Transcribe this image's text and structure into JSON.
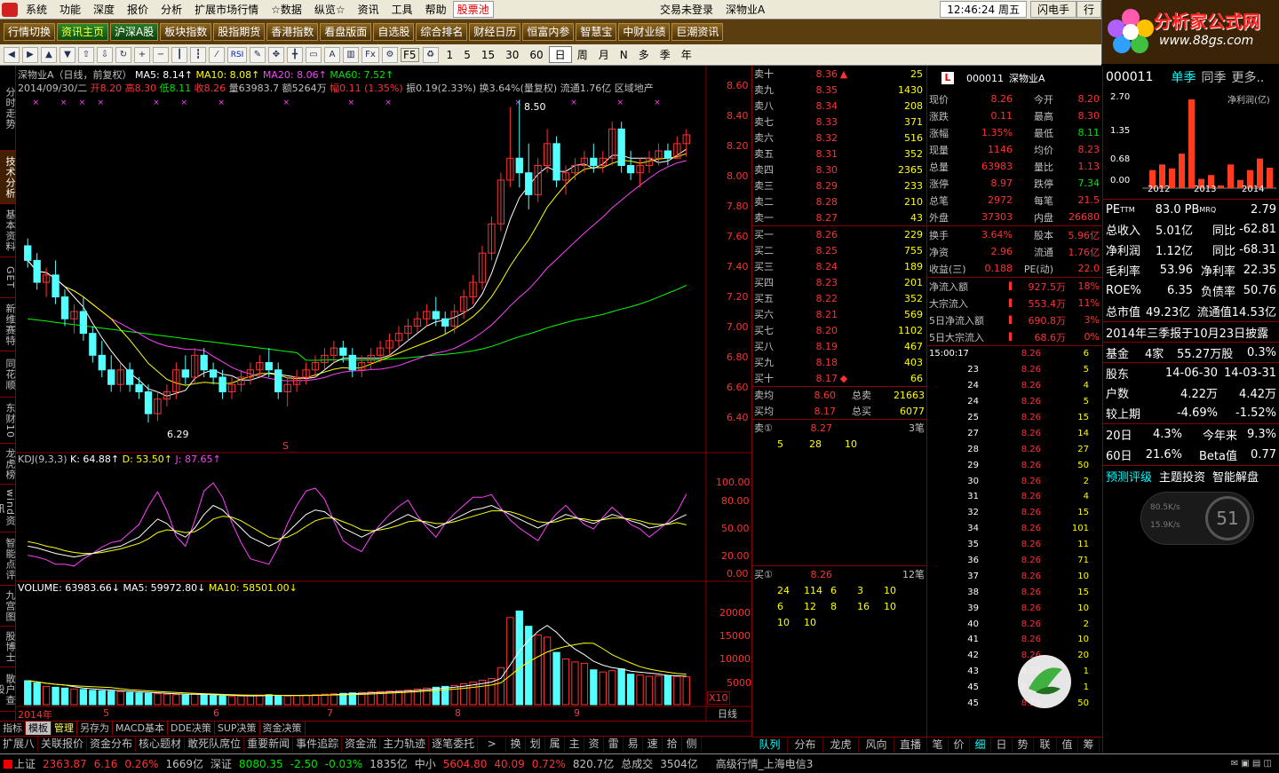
{
  "menu": [
    "系统",
    "功能",
    "深度",
    "报价",
    "分析",
    "扩展市场行情",
    "☆数据",
    "纵览☆",
    "资讯",
    "工具",
    "帮助",
    "股票池"
  ],
  "menu_center": "交易未登录",
  "menu_stock": "深物业A",
  "menu_time": "12:46:24 周五",
  "menu_btn": "闪电手",
  "menu_btn2": "行",
  "nav": [
    "行情切换",
    "资讯主页",
    "沪深A股",
    "板块指数",
    "股指期货",
    "香港指数",
    "看盘版面",
    "自选股",
    "综合排名",
    "财经日历",
    "恒富内参",
    "智慧宝",
    "中财业绩",
    "巨潮资讯"
  ],
  "logo_title": "分析家公式网",
  "logo_url": "www.88gs.com",
  "toolbar_text": [
    "F5",
    "1",
    "5",
    "15",
    "30",
    "60",
    "日",
    "周",
    "月",
    "N",
    "多",
    "季",
    "年"
  ],
  "left_tabs": [
    "分时走势",
    "技术分析",
    "基本资料",
    "GET",
    "新维赛特",
    "同花顺",
    "东财10",
    "龙虎榜",
    "wind资讯",
    "智能点评",
    "九宫图",
    "股博士",
    "散户查股"
  ],
  "chart_header": {
    "line1": "深物业A（日线，前复权）",
    "ma5": "MA5: 8.14↑",
    "ma10": "MA10: 8.08↑",
    "ma20": "MA20: 8.06↑",
    "ma60": "MA60: 7.52↑",
    "date": "2014/09/30/二",
    "open": "开8.20",
    "high": "高8.30",
    "low": "低8.11",
    "close": "收8.26",
    "vol": "量63983.7",
    "amt": "额5264万",
    "chg": "幅0.11 (1.35%)",
    "amp": "振0.19(2.33%)",
    "turn": "换3.64%(量复权)",
    "float": "流通1.76亿",
    "region": "区域地产"
  },
  "price_axis": [
    "8.60",
    "8.40",
    "8.20",
    "8.00",
    "7.80",
    "7.60",
    "7.40",
    "7.20",
    "7.00",
    "6.80",
    "6.60",
    "6.40"
  ],
  "hi_label": "8.50",
  "lo_label": "6.29",
  "s_marker": "S",
  "kdj_header": {
    "name": "KDJ(9,3,3)",
    "k": "K: 64.88↑",
    "d": "D: 53.50↑",
    "j": "J: 87.65↑"
  },
  "kdj_axis": [
    "100.00",
    "80.00",
    "50.00",
    "20.00",
    "0.00"
  ],
  "vol_header": {
    "vol": "VOLUME: 63983.66↓",
    "ma5": "MA5: 59972.80↓",
    "ma10": "MA10: 58501.00↓"
  },
  "vol_axis": [
    "20000",
    "15000",
    "10000",
    "5000"
  ],
  "vol_unit": "X10",
  "date_axis": [
    "2014年",
    "5",
    "6",
    "7",
    "8",
    "9"
  ],
  "period": "日线",
  "bottom_tabs": [
    "指标",
    "模板",
    "管理",
    "另存为",
    "MACD基本",
    "DDE决策",
    "SUP决策",
    "资金决策"
  ],
  "bottom_tabs2": [
    "扩展八",
    "关联报价",
    "资金分布",
    "核心题材",
    "敢死队席位",
    "重要新闻",
    "事件追踪",
    "资金流",
    "主力轨迹",
    "逐笔委托",
    ">",
    "换",
    "划",
    "属",
    "主",
    "资",
    "雷",
    "易",
    "速",
    "拾",
    "侧"
  ],
  "order_book": {
    "sell": [
      [
        "卖十",
        "8.36",
        "25"
      ],
      [
        "卖九",
        "8.35",
        "1430"
      ],
      [
        "卖八",
        "8.34",
        "208"
      ],
      [
        "卖七",
        "8.33",
        "371"
      ],
      [
        "卖六",
        "8.32",
        "516"
      ],
      [
        "卖五",
        "8.31",
        "352"
      ],
      [
        "卖四",
        "8.30",
        "2365"
      ],
      [
        "卖三",
        "8.29",
        "233"
      ],
      [
        "卖二",
        "8.28",
        "210"
      ],
      [
        "卖一",
        "8.27",
        "43"
      ]
    ],
    "buy": [
      [
        "买一",
        "8.26",
        "229"
      ],
      [
        "买二",
        "8.25",
        "755"
      ],
      [
        "买三",
        "8.24",
        "189"
      ],
      [
        "买四",
        "8.23",
        "201"
      ],
      [
        "买五",
        "8.22",
        "352"
      ],
      [
        "买六",
        "8.21",
        "569"
      ],
      [
        "买七",
        "8.20",
        "1102"
      ],
      [
        "买八",
        "8.19",
        "467"
      ],
      [
        "买九",
        "8.18",
        "403"
      ],
      [
        "买十",
        "8.17",
        "66"
      ]
    ],
    "avg_sell": [
      "卖均",
      "8.60",
      "总卖",
      "21663"
    ],
    "avg_buy": [
      "买均",
      "8.17",
      "总买",
      "6077"
    ],
    "sell1_head": [
      "卖①",
      "8.27",
      "3笔"
    ],
    "sell1_q": [
      "5",
      "28",
      "10"
    ],
    "buy1_head": [
      "买①",
      "8.26",
      "12笔"
    ],
    "buy1_q": [
      [
        "24",
        "114",
        "6",
        "3",
        "10"
      ],
      [
        "6",
        "12",
        "8",
        "16",
        "10"
      ],
      [
        "10",
        "10"
      ]
    ],
    "tabs": [
      "队列",
      "分布",
      "龙虎",
      "风向",
      "直播"
    ]
  },
  "quote": {
    "code": "000011",
    "name": "深物业A",
    "rows": [
      [
        "现价",
        "8.26",
        "今开",
        "8.20"
      ],
      [
        "涨跌",
        "0.11",
        "最高",
        "8.30"
      ],
      [
        "涨幅",
        "1.35%",
        "最低",
        "8.11"
      ],
      [
        "现量",
        "1146",
        "均价",
        "8.23"
      ],
      [
        "总量",
        "63983",
        "量比",
        "1.13"
      ],
      [
        "涨停",
        "8.97",
        "跌停",
        "7.34"
      ],
      [
        "总笔",
        "2972",
        "每笔",
        "21.5"
      ],
      [
        "外盘",
        "37303",
        "内盘",
        "26680"
      ]
    ],
    "rows2": [
      [
        "换手",
        "3.64%",
        "股本",
        "5.96亿"
      ],
      [
        "净资",
        "2.96",
        "流通",
        "1.76亿"
      ],
      [
        "收益(三)",
        "0.188",
        "PE(动)",
        "22.0"
      ]
    ],
    "flow": [
      [
        "净流入额",
        "927.5万",
        "18%"
      ],
      [
        "大宗流入",
        "553.4万",
        "11%"
      ],
      [
        "5日净流入额",
        "690.8万",
        "3%"
      ],
      [
        "5日大宗流入",
        "68.6万",
        "0%"
      ]
    ],
    "ticks_start": "15:00:17",
    "ticks": [
      [
        "23",
        "8.26",
        "5"
      ],
      [
        "24",
        "8.26",
        "4"
      ],
      [
        "24",
        "8.26",
        "5"
      ],
      [
        "25",
        "8.26",
        "15"
      ],
      [
        "27",
        "8.26",
        "14"
      ],
      [
        "28",
        "8.26",
        "27"
      ],
      [
        "29",
        "8.26",
        "50"
      ],
      [
        "30",
        "8.26",
        "2"
      ],
      [
        "31",
        "8.26",
        "4"
      ],
      [
        "32",
        "8.26",
        "15"
      ],
      [
        "34",
        "8.26",
        "101"
      ],
      [
        "35",
        "8.26",
        "11"
      ],
      [
        "36",
        "8.26",
        "71"
      ],
      [
        "37",
        "8.26",
        "10"
      ],
      [
        "38",
        "8.26",
        "15"
      ],
      [
        "39",
        "8.26",
        "10"
      ],
      [
        "40",
        "8.26",
        "2"
      ],
      [
        "41",
        "8.26",
        "10"
      ],
      [
        "42",
        "8.26",
        "20"
      ],
      [
        "43",
        "8.26",
        "1"
      ],
      [
        "45",
        "8.26",
        "1"
      ],
      [
        "45",
        "8.26",
        "50"
      ]
    ],
    "first_tick": [
      "8.26",
      "6"
    ],
    "tabs": [
      "笔",
      "价",
      "细",
      "日",
      "势",
      "联",
      "值",
      "筹"
    ]
  },
  "fund": {
    "code": "000011",
    "tabs": [
      "单季",
      "同季",
      "更多.."
    ],
    "chart_title": "净利润(亿)",
    "y_axis": [
      "2.70",
      "1.35",
      "0.68",
      "0.00"
    ],
    "years": [
      "2012",
      "2013",
      "2014"
    ],
    "bars": [
      0.55,
      0.72,
      0.6,
      1.05,
      2.7,
      0.28,
      0.4,
      0.08,
      0.72,
      0.25,
      0.55,
      0.9,
      0.62
    ],
    "pe": [
      "PE",
      "TTM",
      "83.0",
      "PB",
      "MRQ",
      "2.79"
    ],
    "rows": [
      [
        "总收入",
        "5.01亿",
        "同比",
        "-62.81"
      ],
      [
        "净利润",
        "1.12亿",
        "同比",
        "-68.31"
      ],
      [
        "毛利率",
        "53.96",
        "净利率",
        "22.35"
      ],
      [
        "ROE%",
        "6.35",
        "负债率",
        "50.76"
      ],
      [
        "总市值",
        "49.23亿",
        "流通值",
        "14.53亿"
      ]
    ],
    "report": "2014年三季报于10月23日披露",
    "funds": [
      "基金",
      "4家",
      "55.27万股",
      "0.3%"
    ],
    "holder": [
      "股东",
      "14-06-30",
      "14-03-31"
    ],
    "holder_rows": [
      [
        "户数",
        "4.22万",
        "4.42万"
      ],
      [
        "较上期",
        "-4.69%",
        "-1.52%"
      ]
    ],
    "perf": [
      [
        "20日",
        "4.3%",
        "今年来",
        "9.3%"
      ],
      [
        "60日",
        "21.6%",
        "Beta值",
        "0.77"
      ]
    ],
    "links": [
      "预测评级",
      "主题投资",
      "智能解盘"
    ],
    "gauge": {
      "up": "80.5K/s",
      "down": "15.9K/s",
      "pct": "51"
    }
  },
  "status": {
    "sh": "上证",
    "sh_v": "2363.87",
    "sh_c": "6.16",
    "sh_p": "0.26%",
    "sh_a": "1669亿",
    "sz": "深证",
    "sz_v": "8080.35",
    "sz_c": "-2.50",
    "sz_p": "-0.03%",
    "sz_a": "1835亿",
    "zx": "中小",
    "zx_v": "5604.80",
    "zx_c": "40.09",
    "zx_p": "0.72%",
    "zx_a": "820.7亿",
    "tot": "总成交",
    "tot_a": "3504亿",
    "feed": "高级行情_上海电信3"
  },
  "colors": {
    "up": "#ff3232",
    "down": "#54ffff",
    "ma5": "#ffffff",
    "ma10": "#ffff00",
    "ma20": "#ff40ff",
    "ma60": "#00ff00"
  },
  "chart_data": {
    "type": "candlestick",
    "ylim": [
      6.29,
      8.6
    ],
    "note_hidden": false,
    "ohlc": [
      [
        7.5,
        7.55,
        7.35,
        7.4
      ],
      [
        7.4,
        7.45,
        7.2,
        7.25
      ],
      [
        7.25,
        7.35,
        7.15,
        7.3
      ],
      [
        7.3,
        7.4,
        7.1,
        7.15
      ],
      [
        7.15,
        7.2,
        6.95,
        7.0
      ],
      [
        7.0,
        7.1,
        6.9,
        7.05
      ],
      [
        7.05,
        7.15,
        6.85,
        6.9
      ],
      [
        6.9,
        6.95,
        6.7,
        6.75
      ],
      [
        6.75,
        6.85,
        6.6,
        6.65
      ],
      [
        6.65,
        6.75,
        6.5,
        6.55
      ],
      [
        6.55,
        6.7,
        6.5,
        6.65
      ],
      [
        6.65,
        6.7,
        6.5,
        6.55
      ],
      [
        6.55,
        6.6,
        6.45,
        6.5
      ],
      [
        6.5,
        6.55,
        6.29,
        6.35
      ],
      [
        6.35,
        6.5,
        6.3,
        6.45
      ],
      [
        6.45,
        6.55,
        6.4,
        6.5
      ],
      [
        6.5,
        6.7,
        6.45,
        6.65
      ],
      [
        6.65,
        6.75,
        6.55,
        6.6
      ],
      [
        6.6,
        6.8,
        6.55,
        6.75
      ],
      [
        6.75,
        6.8,
        6.6,
        6.65
      ],
      [
        6.65,
        6.7,
        6.55,
        6.6
      ],
      [
        6.6,
        6.65,
        6.45,
        6.5
      ],
      [
        6.5,
        6.6,
        6.45,
        6.55
      ],
      [
        6.55,
        6.65,
        6.5,
        6.6
      ],
      [
        6.6,
        6.7,
        6.55,
        6.65
      ],
      [
        6.65,
        6.75,
        6.6,
        6.7
      ],
      [
        6.7,
        6.8,
        6.6,
        6.65
      ],
      [
        6.65,
        6.7,
        6.45,
        6.5
      ],
      [
        6.5,
        6.6,
        6.4,
        6.55
      ],
      [
        6.55,
        6.65,
        6.5,
        6.6
      ],
      [
        6.6,
        6.7,
        6.55,
        6.65
      ],
      [
        6.65,
        6.75,
        6.6,
        6.7
      ],
      [
        6.7,
        6.8,
        6.65,
        6.75
      ],
      [
        6.75,
        6.85,
        6.7,
        6.8
      ],
      [
        6.8,
        6.85,
        6.7,
        6.75
      ],
      [
        6.75,
        6.8,
        6.6,
        6.65
      ],
      [
        6.65,
        6.75,
        6.6,
        6.7
      ],
      [
        6.7,
        6.8,
        6.65,
        6.75
      ],
      [
        6.75,
        6.85,
        6.7,
        6.8
      ],
      [
        6.8,
        6.9,
        6.75,
        6.85
      ],
      [
        6.85,
        6.95,
        6.8,
        6.9
      ],
      [
        6.9,
        7.0,
        6.85,
        6.95
      ],
      [
        6.95,
        7.05,
        6.9,
        7.0
      ],
      [
        7.0,
        7.1,
        6.95,
        7.05
      ],
      [
        7.05,
        7.15,
        6.95,
        7.0
      ],
      [
        7.0,
        7.05,
        6.9,
        6.95
      ],
      [
        6.95,
        7.1,
        6.9,
        7.05
      ],
      [
        7.05,
        7.2,
        7.0,
        7.15
      ],
      [
        7.15,
        7.3,
        7.1,
        7.25
      ],
      [
        7.25,
        7.5,
        7.2,
        7.45
      ],
      [
        7.45,
        7.7,
        7.4,
        7.65
      ],
      [
        7.65,
        8.0,
        7.6,
        7.95
      ],
      [
        7.95,
        8.45,
        7.9,
        8.1
      ],
      [
        8.1,
        8.5,
        7.9,
        8.0
      ],
      [
        8.0,
        8.2,
        7.75,
        7.85
      ],
      [
        7.85,
        8.1,
        7.8,
        8.05
      ],
      [
        8.05,
        8.3,
        8.0,
        8.2
      ],
      [
        8.2,
        8.25,
        7.9,
        7.95
      ],
      [
        7.95,
        8.05,
        7.85,
        8.0
      ],
      [
        8.0,
        8.1,
        7.95,
        8.05
      ],
      [
        8.05,
        8.15,
        8.0,
        8.1
      ],
      [
        8.1,
        8.2,
        8.0,
        8.05
      ],
      [
        8.05,
        8.15,
        8.0,
        8.1
      ],
      [
        8.1,
        8.35,
        8.05,
        8.3
      ],
      [
        8.3,
        8.35,
        8.0,
        8.05
      ],
      [
        8.05,
        8.15,
        7.95,
        8.0
      ],
      [
        8.0,
        8.1,
        7.9,
        8.05
      ],
      [
        8.05,
        8.15,
        8.0,
        8.1
      ],
      [
        8.1,
        8.2,
        8.05,
        8.15
      ],
      [
        8.15,
        8.2,
        8.05,
        8.1
      ],
      [
        8.1,
        8.25,
        8.1,
        8.2
      ],
      [
        8.2,
        8.3,
        8.11,
        8.26
      ]
    ],
    "volume": [
      5500,
      5000,
      4200,
      4000,
      3800,
      3600,
      3500,
      3300,
      3200,
      3100,
      3000,
      2800,
      2700,
      2600,
      2500,
      2400,
      2300,
      2200,
      2500,
      2300,
      2100,
      2000,
      1900,
      2000,
      2100,
      2200,
      2300,
      2100,
      2000,
      2100,
      2200,
      2300,
      2400,
      2500,
      2600,
      2700,
      2800,
      2900,
      3000,
      3100,
      3200,
      3400,
      3600,
      3800,
      4000,
      4200,
      4400,
      4800,
      5200,
      5600,
      6000,
      8500,
      20000,
      21500,
      18000,
      16000,
      15500,
      12000,
      10500,
      9800,
      9500,
      8000,
      7500,
      7800,
      8200,
      7000,
      6800,
      6500,
      6600,
      6700,
      6500,
      6398
    ],
    "kdj_k": [
      30,
      28,
      25,
      22,
      20,
      18,
      20,
      22,
      25,
      28,
      30,
      35,
      40,
      50,
      60,
      55,
      45,
      40,
      50,
      65,
      75,
      70,
      60,
      50,
      40,
      35,
      30,
      35,
      45,
      55,
      65,
      70,
      68,
      60,
      50,
      45,
      40,
      45,
      50,
      55,
      60,
      65,
      60,
      55,
      50,
      55,
      60,
      65,
      70,
      72,
      75,
      70,
      65,
      60,
      55,
      50,
      55,
      60,
      65,
      62,
      58,
      55,
      60,
      65,
      62,
      58,
      55,
      50,
      52,
      55,
      60,
      64.88
    ],
    "kdj_d": [
      35,
      33,
      30,
      28,
      25,
      23,
      22,
      22,
      23,
      25,
      27,
      30,
      33,
      38,
      45,
      48,
      47,
      45,
      46,
      52,
      60,
      63,
      62,
      58,
      52,
      46,
      40,
      38,
      40,
      45,
      52,
      58,
      61,
      61,
      57,
      53,
      48,
      47,
      48,
      50,
      53,
      57,
      58,
      57,
      55,
      55,
      57,
      60,
      63,
      66,
      69,
      69,
      68,
      65,
      61,
      57,
      56,
      57,
      60,
      61,
      60,
      58,
      59,
      61,
      61,
      60,
      58,
      55,
      54,
      54,
      56,
      53.5
    ]
  }
}
